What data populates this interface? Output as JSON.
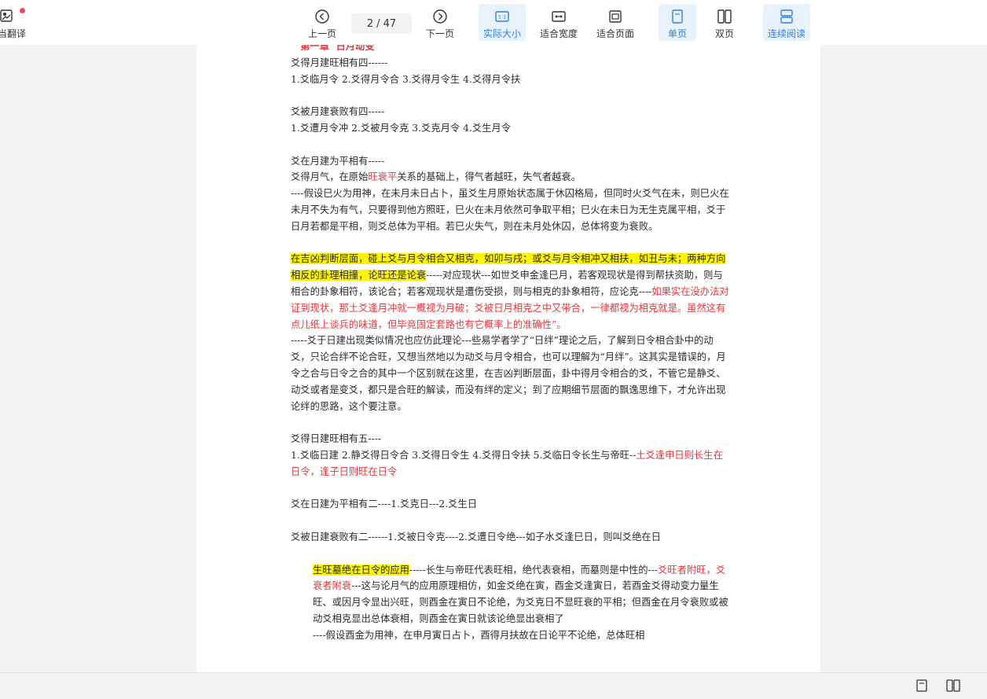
{
  "toolbar": {
    "translate_label": "当翻译",
    "prev_label": "上一页",
    "next_label": "下一页",
    "page_current": "2",
    "page_total": "/ 47",
    "actual_size_label": "实际大小",
    "fit_width_label": "适合宽度",
    "fit_page_label": "适合页面",
    "single_page_label": "单页",
    "double_page_label": "双页",
    "continuous_label": "连续阅读",
    "actual_size_icon_text": "1:1"
  },
  "colors": {
    "accent": "#2f7fe6",
    "active_bg": "#e8f2fd",
    "highlight": "#fff500",
    "red_text": "#e8363a",
    "badge": "#f5455c"
  },
  "document": {
    "heading": "第一章  日月动变",
    "p1_title": "爻得月建旺相有四------",
    "p1_items": "1.爻临月令 2.爻得月令合 3.爻得月令生 4.爻得月令扶",
    "p2_title": "爻被月建衰败有四-----",
    "p2_items": "1.爻遭月令冲 2.爻被月令克 3.爻克月令 4.爻生月令",
    "p3_title": "爻在月建为平相有-----",
    "p3_l1_a": "爻得月气，在原始",
    "p3_l1_red": "旺衰平",
    "p3_l1_b": "关系的基础上，得气者越旺，失气者越衰。",
    "p3_l2": "----假设巳火为用神，在未月未日占卜，虽爻生月原始状态属于休囚格局，但同时火爻气在未，则巳火在未月不失为有气，只要得到他方照旺，巳火在未月依然可争取平相；巳火在未日为无生克属平相，爻于日月若都是平相，则爻总体为平相。若巳火失气，则在未月处休囚，总体将变为衰败。",
    "p4_hl": "在吉凶判断层面，碰上爻与月令相合又相克，如卯与戌；或爻与月令相冲又相扶，如丑与未；两种方向相反的卦理相撞，论旺还是论衰",
    "p4_a": "-----对应现状---如世爻申金逢巳月，若客观现状是得到帮扶资助，则与相合的卦象相符，该论合；若客观现状是遭伤受损，则与相克的卦象相符，应论克----",
    "p4_red": "如果实在没办法对证到现状，那土爻逢月冲就一概视为月破；爻被日月相克之中又带合，一律都视为相克就是。虽然这有点儿纸上谈兵的味道，但毕竟固定套路也有它概率上的准确性”。",
    "p5": "-----爻于日建出现类似情况也应仿此理论---些易学者学了“日绊”理论之后，了解到日令相合卦中的动爻，只论合绊不论合旺，又想当然地以为动爻与月令相合，也可以理解为“月绊”。这其实是错误的，月令之合与日令之合的其中一个区别就在这里，在吉凶判断层面，卦中得月令相合的爻，不管它是静爻、动爻或者是变爻，都只是合旺的解读，而没有绊的定义；到了应期细节层面的飘逸思维下，才允许出现论绊的思路，这个要注意。",
    "p6_title": "爻得日建旺相有五----",
    "p6_items": "1.爻临日建 2.静爻得日令合 3.爻得日令生 4.爻得日令扶 5.爻临日令长生与帝旺--",
    "p6_red": "土爻逢申日则长生在日令，逢子日则旺在日令",
    "p7": "爻在日建为平相有二----1.爻克日---2.爻生日",
    "p8": "爻被日建衰败有二------1.爻被日令克----2.爻遭日令绝---如子水爻逢巳日，则叫爻绝在日",
    "p9_hl": "生旺墓绝在日令的应用",
    "p9_a": "-----长生与帝旺代表旺相，绝代表衰相，而墓则是中性的---",
    "p9_red": "爻旺者附旺，爻衰者附衰",
    "p9_b": "---这与论月气的应用原理相仿，如金爻绝在寅，酉金爻逢寅日，若酉金爻得动变力量生旺、或因月令显出兴旺，则酉金在寅日不论绝，为爻克日不显旺衰的平相；但酉金在月令衰败或被动爻相克显出总体衰相，则酉金在寅日就该论绝显出衰相了",
    "p10": "----假设酉金为用神，在申月寅日占卜，酉得月扶故在日论平不论绝，总体旺相"
  },
  "statusbar": {
    "single_view_icon": "single-page-icon",
    "double_view_icon": "double-page-icon"
  }
}
